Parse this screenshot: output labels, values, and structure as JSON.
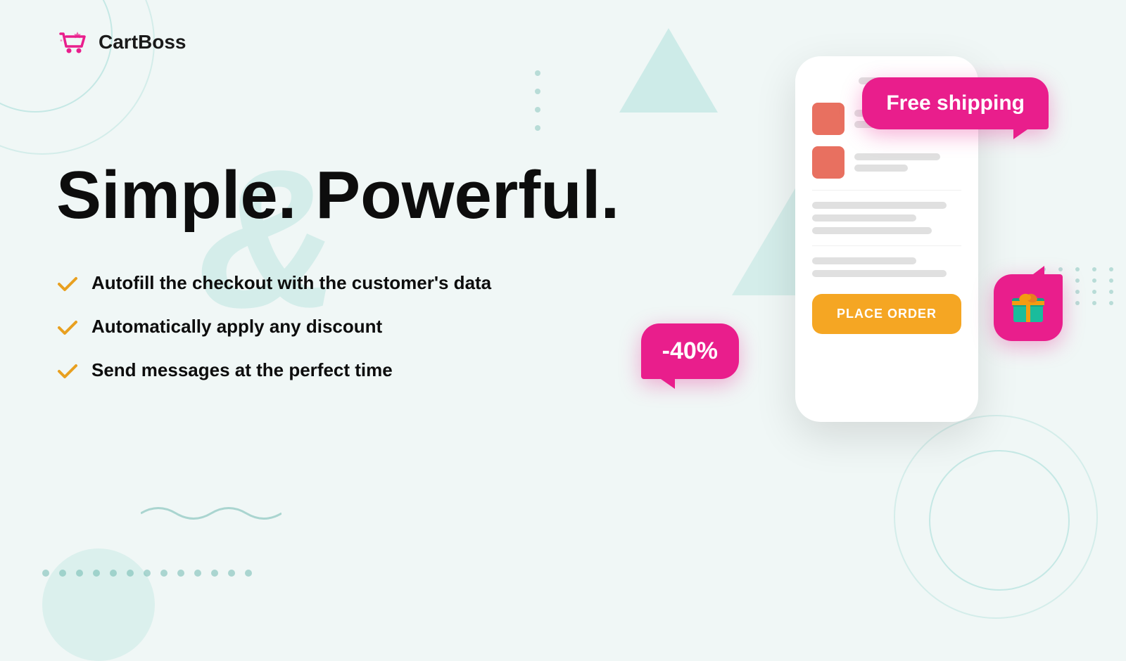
{
  "logo": {
    "name": "CartBoss",
    "icon_label": "cart-icon"
  },
  "headline": {
    "line1": "Simple. Powerful."
  },
  "features": [
    {
      "id": 1,
      "text": "Autofill the checkout with the customer's data"
    },
    {
      "id": 2,
      "text": "Automatically apply any discount"
    },
    {
      "id": 3,
      "text": "Send messages at the perfect time"
    }
  ],
  "phone": {
    "place_order_label": "PLACE ORDER"
  },
  "bubbles": {
    "free_shipping": "Free shipping",
    "discount": "-40%",
    "gift_icon_label": "gift-icon"
  },
  "colors": {
    "accent": "#e91e8c",
    "bg": "#f0f7f6",
    "check": "#e8a020",
    "phone_btn": "#f5a623",
    "teal_light": "#c8e8e4"
  }
}
